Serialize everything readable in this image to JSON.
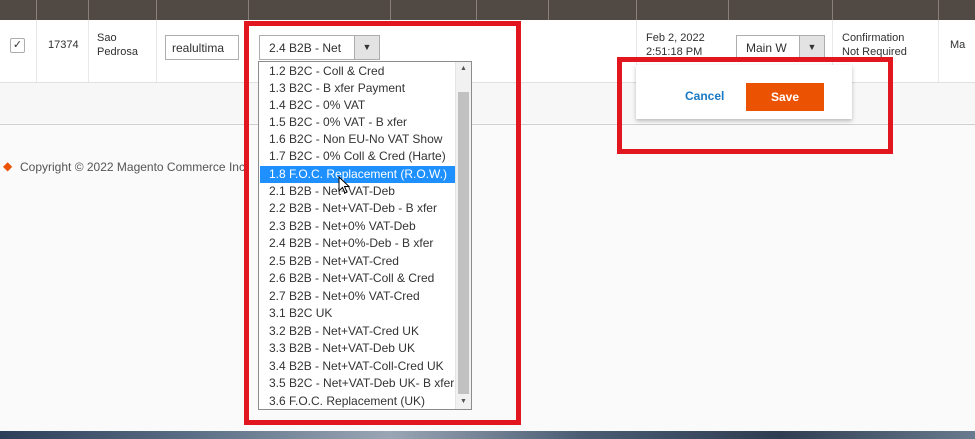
{
  "row": {
    "checkbox_mark": "✓",
    "id": "17374",
    "city": "Sao\nPedrosa",
    "input_value": "realultima",
    "tax_select_value": "2.4 B2B - Net",
    "date_line1": "Feb 2, 2022",
    "date_line2": "2:51:18 PM",
    "warehouse_select_value": "Main W",
    "status_line1": "Confirmation",
    "status_line2": "Not Required",
    "last_col": "Ma"
  },
  "actions": {
    "cancel_label": "Cancel",
    "save_label": "Save"
  },
  "footer": {
    "copyright": "Copyright © 2022 Magento Commerce Inc."
  },
  "dropdown": {
    "options": [
      "1.2 B2C - Coll & Cred",
      "1.3 B2C - B xfer Payment",
      "1.4 B2C - 0% VAT",
      "1.5 B2C - 0% VAT - B xfer",
      "1.6 B2C - Non EU-No VAT Show",
      "1.7 B2C - 0% Coll & Cred (Harte)",
      "1.8 F.O.C. Replacement (R.O.W.)",
      "2.1 B2B - Net+VAT-Deb",
      "2.2 B2B - Net+VAT-Deb - B xfer",
      "2.3 B2B - Net+0% VAT-Deb",
      "2.4 B2B - Net+0%-Deb - B xfer",
      "2.5 B2B - Net+VAT-Cred",
      "2.6 B2B - Net+VAT-Coll & Cred",
      "2.7 B2B - Net+0% VAT-Cred",
      "3.1 B2C UK",
      "3.2 B2B - Net+VAT-Cred UK",
      "3.3 B2B - Net+VAT-Deb UK",
      "3.4 B2B - Net+VAT-Coll-Cred UK",
      "3.5 B2C - Net+VAT-Deb UK- B xfer",
      "3.6 F.O.C. Replacement (UK)"
    ],
    "selected_index": 6
  },
  "colors": {
    "highlight": "#e1161f",
    "selected": "#1e90ff",
    "save": "#eb5202",
    "link": "#1979c3"
  },
  "icons": {
    "scroll_up": "▲",
    "scroll_down": "▼",
    "select_arrow": "▼"
  }
}
